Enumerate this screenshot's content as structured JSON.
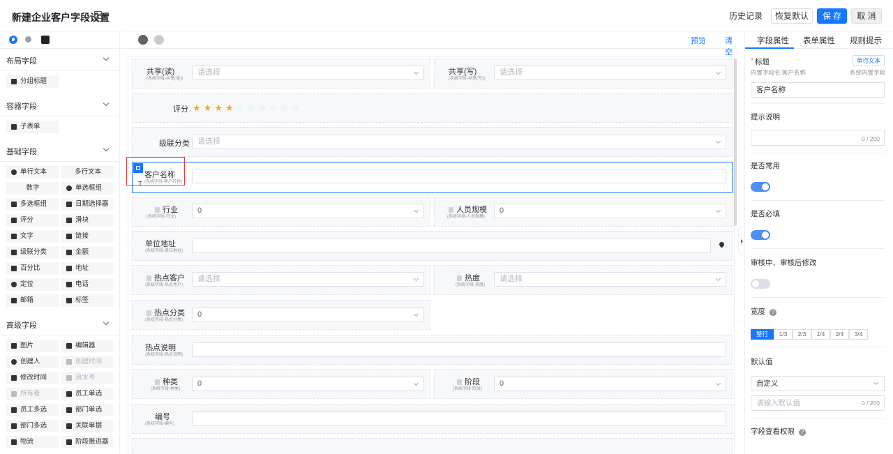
{
  "header": {
    "title": "新建企业客户字段设置",
    "history": "历史记录",
    "reset": "恢复默认",
    "save": "保 存",
    "cancel": "取 消"
  },
  "left": {
    "sections": [
      {
        "title": "布局字段",
        "items": [
          {
            "label": "分组标题",
            "icon": "group-title-icon"
          }
        ]
      },
      {
        "title": "容器字段",
        "items": [
          {
            "label": "子表单",
            "icon": "subform-icon"
          }
        ]
      },
      {
        "title": "基础字段",
        "items": [
          {
            "label": "单行文本",
            "icon": "single-text-icon"
          },
          {
            "label": "多行文本",
            "icon": ""
          },
          {
            "label": "数字",
            "icon": ""
          },
          {
            "label": "单选框组",
            "icon": "radio-icon"
          },
          {
            "label": "多选框组",
            "icon": "checkbox-icon"
          },
          {
            "label": "日期选择器",
            "icon": "date-icon"
          },
          {
            "label": "评分",
            "icon": "rate-icon"
          },
          {
            "label": "滑块",
            "icon": "slider-icon"
          },
          {
            "label": "文字",
            "icon": "text-icon"
          },
          {
            "label": "链接",
            "icon": "link-icon"
          },
          {
            "label": "级联分类",
            "icon": "cascader-icon"
          },
          {
            "label": "金额",
            "icon": "money-icon"
          },
          {
            "label": "百分比",
            "icon": "percent-icon"
          },
          {
            "label": "地址",
            "icon": "address-icon"
          },
          {
            "label": "定位",
            "icon": "location-icon"
          },
          {
            "label": "电话",
            "icon": "phone-icon"
          },
          {
            "label": "邮箱",
            "icon": "mail-icon"
          },
          {
            "label": "标签",
            "icon": "tag-icon"
          }
        ]
      },
      {
        "title": "高级字段",
        "items": [
          {
            "label": "图片",
            "icon": "image-icon"
          },
          {
            "label": "编辑器",
            "icon": "editor-icon"
          },
          {
            "label": "创建人",
            "icon": "creator-icon"
          },
          {
            "label": "创建时间",
            "icon": "create-time-icon",
            "disabled": true
          },
          {
            "label": "修改时间",
            "icon": "modify-time-icon"
          },
          {
            "label": "流水号",
            "icon": "serial-icon",
            "disabled": true
          },
          {
            "label": "所有者",
            "icon": "owner-icon",
            "disabled": true
          },
          {
            "label": "员工单选",
            "icon": "employee-icon"
          },
          {
            "label": "员工多选",
            "icon": "employees-icon"
          },
          {
            "label": "部门单选",
            "icon": "dept-icon"
          },
          {
            "label": "部门多选",
            "icon": "depts-icon"
          },
          {
            "label": "关联单据",
            "icon": "relation-icon"
          },
          {
            "label": "物流",
            "icon": "logistics-icon"
          },
          {
            "label": "阶段推进器",
            "icon": "stage-icon"
          }
        ]
      }
    ]
  },
  "center": {
    "preview": "预览",
    "clear": "清空"
  },
  "fields": {
    "share_read": {
      "label": "共享(读)",
      "sub": "(系统字段-共享(读))",
      "placeholder": "请选择"
    },
    "share_write": {
      "label": "共享(写)",
      "sub": "(系统字段-共享(写))",
      "placeholder": "请选择"
    },
    "rating": {
      "label": "评分",
      "value": 4,
      "max": 10
    },
    "cascade": {
      "label": "级联分类",
      "placeholder": "请选择"
    },
    "customer_name": {
      "label": "客户名称",
      "sub": "(系统字段-客户名称)"
    },
    "industry": {
      "label": "行业",
      "sub": "(系统字段-行业)",
      "value": "0"
    },
    "staff_size": {
      "label": "人员规模",
      "sub": "(系统字段-人员规模)",
      "value": "0"
    },
    "address": {
      "label": "单位地址",
      "sub": "(系统字段-单位地址)"
    },
    "hot_customer": {
      "label": "热点客户",
      "sub": "(系统字段-热点客户)",
      "placeholder": "请选择"
    },
    "heat": {
      "label": "热度",
      "sub": "(系统字段-热度)",
      "placeholder": "请选择"
    },
    "hot_category": {
      "label": "热点分类",
      "sub": "(系统字段-热点分类)",
      "value": "0"
    },
    "hot_desc": {
      "label": "热点说明",
      "sub": "(系统字段-热点说明)"
    },
    "kind": {
      "label": "种类",
      "sub": "(系统字段-种类)",
      "value": "0"
    },
    "stage": {
      "label": "阶段",
      "sub": "(系统字段-阶段)",
      "value": "0"
    },
    "number": {
      "label": "编号",
      "sub": "(系统字段-编号)"
    }
  },
  "right": {
    "tabs": [
      "字段属性",
      "表单属性",
      "规则提示"
    ],
    "title_label": "标题",
    "type_tag": "单行文本",
    "builtin_name": "内置字段名:客户名称",
    "builtin_tag": "系统内置字段",
    "title_value": "客户名称",
    "hint_label": "提示说明",
    "hint_count": "0 / 200",
    "common_label": "是否常用",
    "required_label": "是否必填",
    "review_label": "审核中、审核后修改",
    "width_label": "宽度",
    "widths": [
      "整行",
      "1/3",
      "2/3",
      "1/4",
      "2/4",
      "3/4"
    ],
    "default_label": "默认值",
    "default_type": "自定义",
    "default_placeholder": "请输入默认值",
    "default_count": "0 / 200",
    "perm_label": "字段查看权限"
  },
  "colors": {
    "accent": "#1677ff",
    "star": "#f5a623"
  }
}
